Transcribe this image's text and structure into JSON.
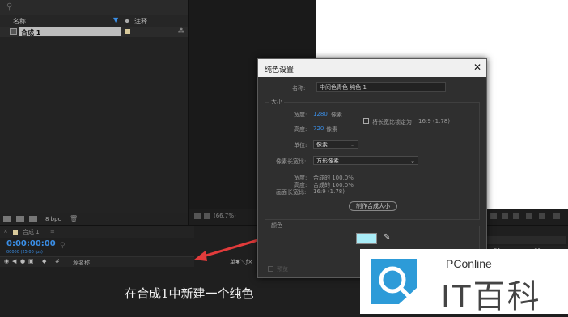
{
  "project": {
    "search_icon": "search-icon",
    "col_name": "名称",
    "col_comment": "注释",
    "items": [
      {
        "name": "合成 1"
      }
    ],
    "bit_depth": "8 bpc"
  },
  "timeline": {
    "tab_label": "合成 1",
    "timecode": "0:00:00:00",
    "fps_text": "00000 (25.00 fps)",
    "col_source_name": "源名称",
    "ruler": [
      "01s",
      "02s"
    ]
  },
  "viewer": {
    "zoom": "(66.7%)",
    "color_white": "#ffffff"
  },
  "dialog": {
    "title": "纯色设置",
    "name_label": "名称:",
    "name_value": "中间色青色 纯色 1",
    "size_section": "大小",
    "width_label": "宽度:",
    "width_value": "1280",
    "height_label": "高度:",
    "height_value": "720",
    "px_unit": "像素",
    "lock_aspect_label": "将长宽比锁定为",
    "lock_aspect_ratio": "16:9 (1.78)",
    "units_label": "单位:",
    "units_value": "像素",
    "pixel_aspect_label": "像素长宽比:",
    "pixel_aspect_value": "方形像素",
    "comp_width_label": "宽度:",
    "comp_width_value": "合成的 100.0%",
    "comp_height_label": "高度:",
    "comp_height_value": "合成的 100.0%",
    "frame_aspect_label": "画面长宽比:",
    "frame_aspect_value": "16:9 (1.78)",
    "make_comp_size": "制作合成大小",
    "color_section": "颜色",
    "swatch_color": "#a9ecf7",
    "preview_label": "预览"
  },
  "caption": "在合成1中新建一个纯色",
  "watermark": {
    "brand_en": "PConline",
    "brand_cn": "IT百科",
    "accent": "#2d9bd8"
  }
}
